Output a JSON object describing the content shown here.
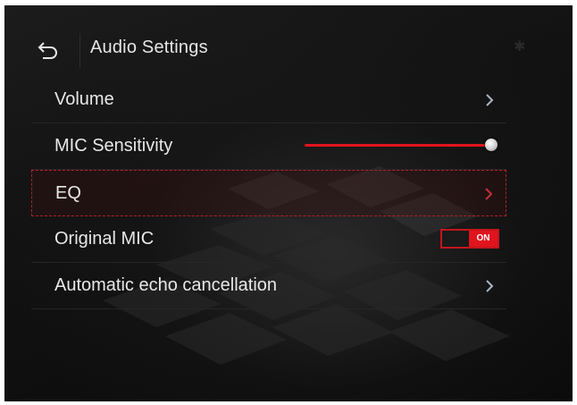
{
  "header": {
    "title": "Audio Settings",
    "back_icon": "back-arrow-icon",
    "status_icon": "bluetooth-icon"
  },
  "settings": [
    {
      "label": "Volume",
      "control": "chevron"
    },
    {
      "label": "MIC Sensitivity",
      "control": "slider",
      "slider_level": 1.0
    },
    {
      "label": "EQ",
      "control": "chevron",
      "selected": true
    },
    {
      "label": "Original MIC",
      "control": "toggle",
      "toggle_text": "ON",
      "toggle_state": true
    },
    {
      "label": "Automatic echo cancellation",
      "control": "chevron"
    }
  ],
  "colors": {
    "accent": "#e0141e",
    "text": "#e8e8e8",
    "background": "#111111",
    "selection_border": "#b0202a"
  }
}
